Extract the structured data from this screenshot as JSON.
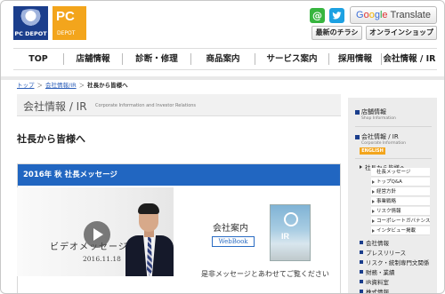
{
  "header": {
    "logo_text": "PC DEPOT",
    "pc_big": "PC",
    "pc_small": "DEPOT",
    "mail_icon": "mail-icon",
    "twitter_icon": "twitter-icon",
    "translate": {
      "google": [
        "G",
        "o",
        "o",
        "g",
        "l",
        "e"
      ],
      "label": "Translate"
    },
    "flyer_button": "最新のチラシ",
    "shop_button": "オンラインショップ"
  },
  "nav": {
    "items": [
      "TOP",
      "店舗情報",
      "診断・修理",
      "商品案内",
      "サービス案内",
      "採用情報",
      "会社情報 / IR"
    ]
  },
  "breadcrumb": {
    "top": "トップ",
    "company": "会社情報/IR",
    "current": "社長から皆様へ",
    "sep": "＞"
  },
  "section": {
    "title": "会社情報 / IR",
    "subtitle": "Corporate Information and Investor Relations"
  },
  "page": {
    "title": "社長から皆様へ"
  },
  "message": {
    "heading": "2016年 秋 社長メッセージ",
    "video_label": "ビデオメッセージ",
    "video_date": "2016.11.18",
    "company_label": "会社案内",
    "webbook": "WebBook",
    "caption": "是非メッセージとあわせてご覧ください",
    "book_word": "IR"
  },
  "sidebar": {
    "store": {
      "label": "店舗情報",
      "sub": "Shop Information"
    },
    "company": {
      "label": "会社情報 / IR",
      "sub": "Corporate Information",
      "english": "ENGLISH"
    },
    "president": "社長から皆様へ",
    "sub_items": [
      "社長メッセージ",
      "トップQ&A",
      "経営方針",
      "事業戦略",
      "リスク情報",
      "コーポレートガバナンス",
      "インタビュー掲載"
    ],
    "bottom_items": [
      "会社情報",
      "プレスリリース",
      "リスク・統制専門文関係",
      "財務・業績",
      "IR資料室",
      "株式情報"
    ]
  },
  "colors": {
    "brand_blue": "#1b3e8c",
    "accent_orange": "#f3a51c",
    "panel_blue": "#2166c1"
  }
}
